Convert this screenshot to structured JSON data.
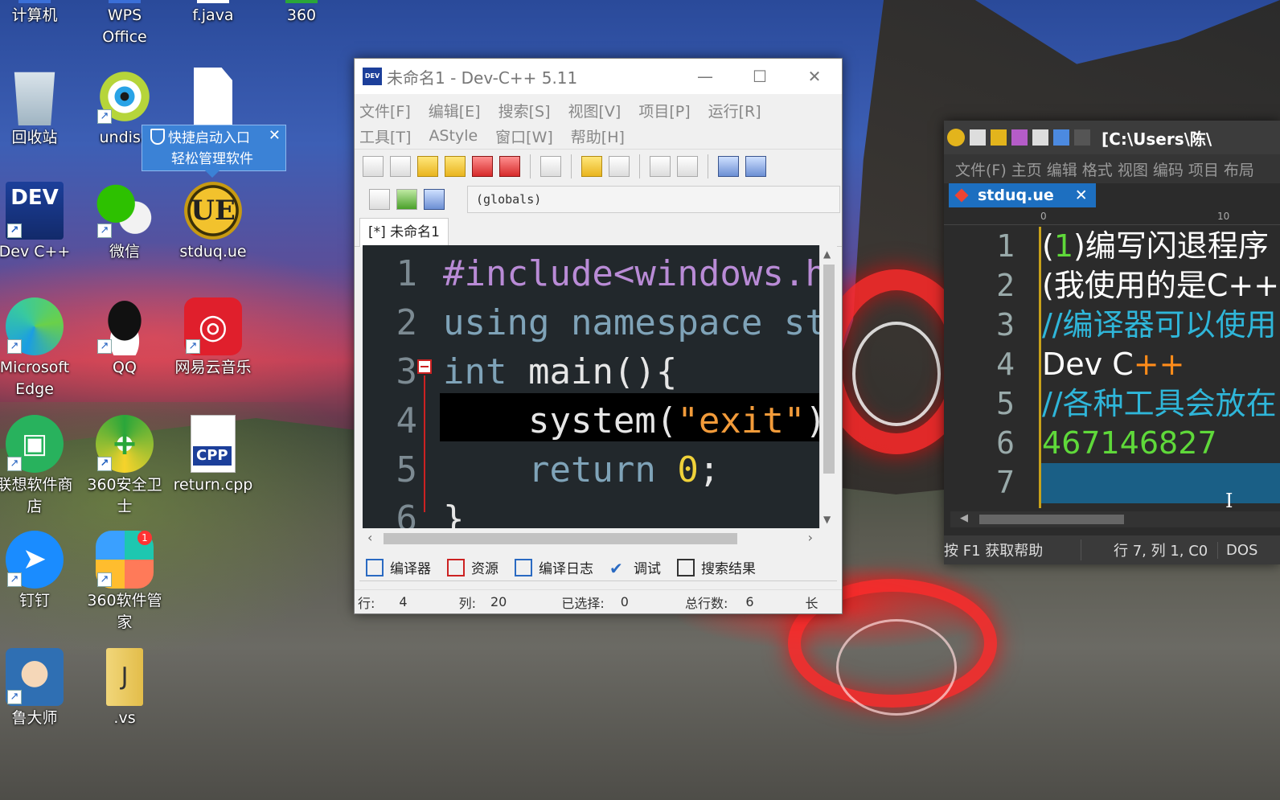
{
  "desktop": {
    "icons": [
      {
        "label": "计算机"
      },
      {
        "label": "WPS\nOffice"
      },
      {
        "label": "f.java"
      },
      {
        "label": "360"
      },
      {
        "label": "回收站"
      },
      {
        "label": "undisa"
      },
      {
        "label": "Dev C++"
      },
      {
        "label": "微信"
      },
      {
        "label": "stduq.ue"
      },
      {
        "label": "Microsoft Edge"
      },
      {
        "label": "QQ"
      },
      {
        "label": "网易云音乐"
      },
      {
        "label": "联想软件商店"
      },
      {
        "label": "360安全卫士"
      },
      {
        "label": "return.cpp"
      },
      {
        "label": "钉钉"
      },
      {
        "label": "360软件管家"
      },
      {
        "label": "鲁大师"
      },
      {
        "label": ".vs"
      }
    ],
    "badges": {
      "dev_icon_text": "DEV",
      "ue_icon_text": "UE",
      "cpp_tag": "CPP",
      "store_badge": "1"
    }
  },
  "tooltip": {
    "line1": "快捷启动入口",
    "line2": "轻松管理软件",
    "close": "✕"
  },
  "devcpp": {
    "icon_text": "DEV",
    "title": "未命名1 - Dev-C++ 5.11",
    "window_buttons": {
      "minimize": "—",
      "maximize": "☐",
      "close": "✕"
    },
    "menu_row1": [
      "文件[F]",
      "编辑[E]",
      "搜索[S]",
      "视图[V]",
      "项目[P]",
      "运行[R]"
    ],
    "menu_row2": [
      "工具[T]",
      "AStyle",
      "窗口[W]",
      "帮助[H]"
    ],
    "scope_selector": "(globals)",
    "tab": "[*] 未命名1",
    "code_lines": [
      {
        "num": "1",
        "parts": [
          {
            "t": "#include<windows.h>",
            "c": "pp"
          }
        ]
      },
      {
        "num": "2",
        "parts": [
          {
            "t": "using namespace std;",
            "c": "kw"
          }
        ]
      },
      {
        "num": "3",
        "parts": [
          {
            "t": "int ",
            "c": "kw"
          },
          {
            "t": "main(){",
            "c": "tx"
          }
        ]
      },
      {
        "num": "4",
        "parts": [
          {
            "t": "    system(",
            "c": "tx"
          },
          {
            "t": "\"exit\"",
            "c": "st"
          },
          {
            "t": ");",
            "c": "tx"
          }
        ]
      },
      {
        "num": "5",
        "parts": [
          {
            "t": "    return ",
            "c": "kw"
          },
          {
            "t": "0",
            "c": "nm"
          },
          {
            "t": ";",
            "c": "tx"
          }
        ]
      },
      {
        "num": "6",
        "parts": [
          {
            "t": "}",
            "c": "tx"
          }
        ]
      }
    ],
    "bottom_tabs": [
      "编译器",
      "资源",
      "编译日志",
      "调试",
      "搜索结果"
    ],
    "status": {
      "row_label": "行:",
      "row_value": "4",
      "col_label": "列:",
      "col_value": "20",
      "sel_label": "已选择:",
      "sel_value": "0",
      "total_label": "总行数:",
      "total_value": "6",
      "len_label": "长"
    }
  },
  "ultraedit": {
    "path": "[C:\\Users\\陈\\",
    "menus": [
      "文件(F)",
      "主页",
      "编辑",
      "格式",
      "视图",
      "编码",
      "项目",
      "布局"
    ],
    "tab": "stduq.ue",
    "tab_close": "✕",
    "ruler": {
      "m0": "0",
      "m10": "10"
    },
    "lines": [
      {
        "num": "1",
        "parts": [
          {
            "t": "(",
            "c": "w"
          },
          {
            "t": "1",
            "c": "g"
          },
          {
            "t": ")编写闪退程序",
            "c": "w"
          }
        ]
      },
      {
        "num": "2",
        "parts": [
          {
            "t": "(我使用的是C++)",
            "c": "w"
          }
        ]
      },
      {
        "num": "3",
        "parts": [
          {
            "t": "//编译器可以使用",
            "c": "c"
          }
        ]
      },
      {
        "num": "4",
        "parts": [
          {
            "t": "Dev C",
            "c": "w"
          },
          {
            "t": "++",
            "c": "o"
          }
        ]
      },
      {
        "num": "5",
        "parts": [
          {
            "t": "//各种工具会放在",
            "c": "c"
          }
        ]
      },
      {
        "num": "6",
        "parts": [
          {
            "t": "467146827",
            "c": "g"
          }
        ]
      },
      {
        "num": "7",
        "parts": []
      }
    ],
    "status": {
      "help": "按 F1 获取帮助",
      "pos": "行 7, 列 1, C0",
      "enc": "DOS"
    }
  }
}
